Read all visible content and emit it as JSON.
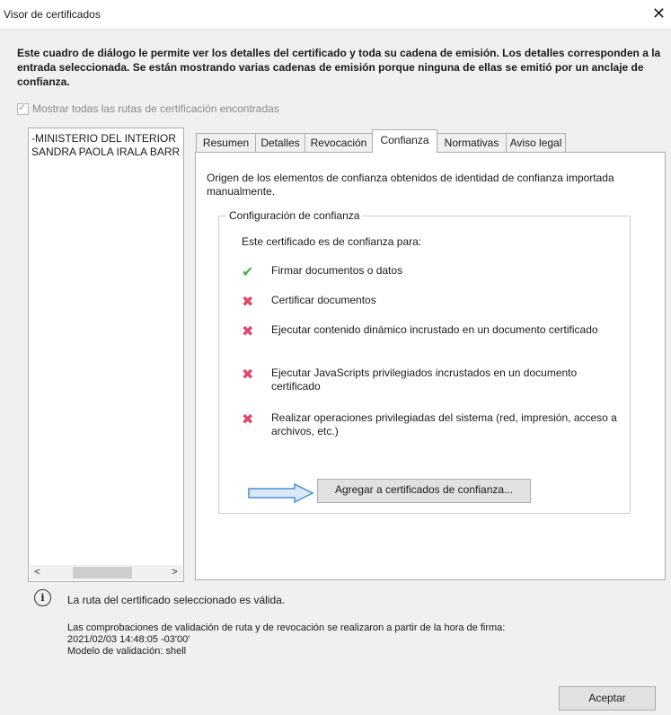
{
  "window": {
    "title": "Visor de certificados",
    "close_glyph": "✕"
  },
  "description": "Este cuadro de diálogo le permite ver los detalles del certificado y toda su cadena de emisión. Los detalles corresponden a la entrada seleccionada. Se están mostrando varias cadenas de emisión porque ninguna de ellas se emitió por un anclaje de confianza.",
  "show_all_paths": {
    "label": "Mostrar todas las rutas de certificación encontradas",
    "checked": true,
    "disabled": true
  },
  "tree": {
    "items": [
      "-MINISTERIO DEL INTERIOR",
      "SANDRA PAOLA IRALA BARR"
    ],
    "scroll_left": "<",
    "scroll_right": ">"
  },
  "tabs": [
    "Resumen",
    "Detalles",
    "Revocación",
    "Confianza",
    "Normativas",
    "Aviso legal"
  ],
  "active_tab": "Confianza",
  "trust": {
    "origin": "Origen de los elementos de confianza obtenidos de identidad de confianza importada manualmente.",
    "group_label": "Configuración de confianza",
    "trusted_for_label": "Este certificado es de confianza para:",
    "permissions": [
      {
        "label": "Firmar documentos o datos",
        "allowed": true,
        "icon": "check-icon"
      },
      {
        "label": "Certificar documentos",
        "allowed": false,
        "icon": "x-icon"
      },
      {
        "label": "Ejecutar contenido dinámico incrustado en un documento certificado",
        "allowed": false,
        "icon": "x-icon"
      },
      {
        "label": "Ejecutar JavaScripts privilegiados incrustados en un documento certificado",
        "allowed": false,
        "icon": "x-icon"
      },
      {
        "label": "Realizar operaciones privilegiadas del sistema (red, impresión, acceso a archivos, etc.)",
        "allowed": false,
        "icon": "x-icon"
      }
    ],
    "add_button": "Agregar a certificados de confianza..."
  },
  "status": {
    "icon": "info-icon",
    "valid_text": "La ruta del certificado seleccionado es válida.",
    "check_line1": "Las comprobaciones de validación de ruta y de revocación se realizaron a partir de la hora de firma:",
    "check_line2": "2021/02/03 14:48:05 -03'00'",
    "check_line3": "Modelo de validación: shell"
  },
  "accept_button": "Aceptar",
  "colors": {
    "check": "#4caf50",
    "cross": "#e0456a",
    "arrow": "#4a90d9"
  }
}
